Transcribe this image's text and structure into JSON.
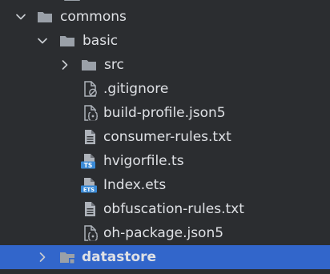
{
  "project_tree": {
    "items": [
      {
        "label": "commons",
        "type": "folder",
        "expanded": true
      },
      {
        "label": "basic",
        "type": "folder",
        "expanded": true
      },
      {
        "label": "src",
        "type": "folder",
        "expanded": false
      },
      {
        "label": ".gitignore",
        "type": "file",
        "icon": "gitignore-file-icon"
      },
      {
        "label": "build-profile.json5",
        "type": "file",
        "icon": "json5-file-icon"
      },
      {
        "label": "consumer-rules.txt",
        "type": "file",
        "icon": "text-file-icon"
      },
      {
        "label": "hvigorfile.ts",
        "type": "file",
        "icon": "typescript-file-icon",
        "badge": "TS"
      },
      {
        "label": "Index.ets",
        "type": "file",
        "icon": "ets-file-icon",
        "badge": "ETS"
      },
      {
        "label": "obfuscation-rules.txt",
        "type": "file",
        "icon": "text-file-icon"
      },
      {
        "label": "oh-package.json5",
        "type": "file",
        "icon": "json5-file-icon"
      },
      {
        "label": "datastore",
        "type": "module-folder",
        "expanded": false,
        "selected": true
      }
    ]
  },
  "colors": {
    "background": "#2b2d30",
    "text": "#dfe1e5",
    "selection": "#4a6eb8",
    "folder": "#9aa0a8",
    "ts_badge": "#3a8ad6",
    "ets_badge": "#3a8ad6"
  }
}
